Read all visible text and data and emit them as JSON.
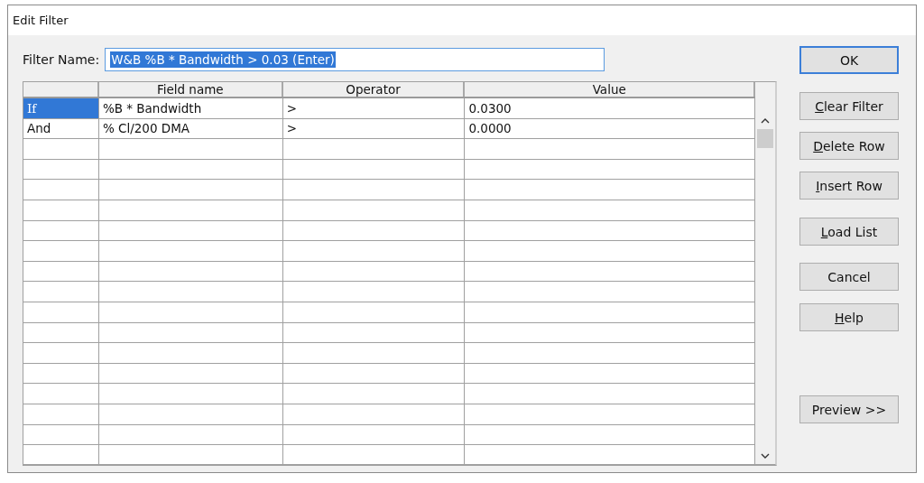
{
  "window": {
    "title": "Edit Filter"
  },
  "filter_name": {
    "label": "Filter Name:",
    "value": "W&B %B * Bandwidth > 0.03 (Enter)",
    "text_selected": true
  },
  "table": {
    "columns": [
      "Field name",
      "Operator",
      "Value"
    ],
    "rows": [
      {
        "connector": "If",
        "field": "%B * Bandwidth",
        "operator": ">",
        "value": "0.0300",
        "selected": true
      },
      {
        "connector": "And",
        "field": "% Cl/200 DMA",
        "operator": ">",
        "value": "0.0000",
        "selected": false
      }
    ]
  },
  "buttons": [
    {
      "after": "OK",
      "default": true
    },
    {
      "key": "C",
      "after": "lear Filter",
      "default": false
    },
    {
      "key": "D",
      "after": "elete Row",
      "default": false
    },
    {
      "key": "I",
      "after": "nsert Row",
      "default": false
    },
    {
      "key": "L",
      "after": "oad List",
      "default": false
    },
    {
      "after": "Cancel",
      "default": false
    },
    {
      "key": "H",
      "after": "elp",
      "default": false
    },
    {
      "after": "Preview >>",
      "default": false
    }
  ]
}
